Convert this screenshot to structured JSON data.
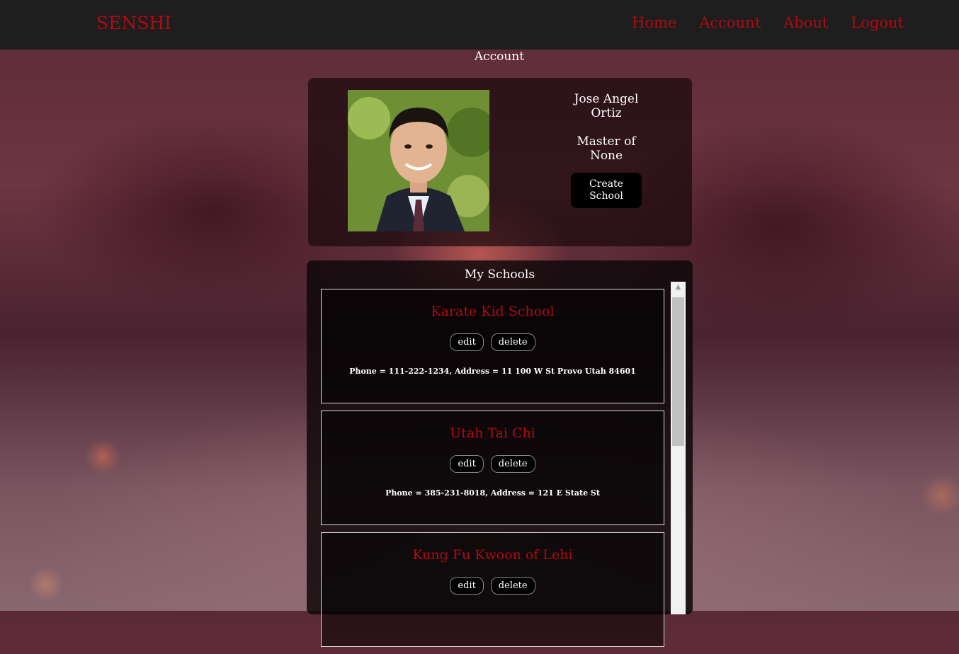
{
  "nav": {
    "brand": "SENSHI",
    "links": [
      "Home",
      "Account",
      "About",
      "Logout"
    ]
  },
  "page": {
    "title": "Account"
  },
  "profile": {
    "name": "Jose Angel Ortiz",
    "rank": "Master of None",
    "create_button": "Create School"
  },
  "schools": {
    "title": "My Schools",
    "edit_label": "edit",
    "delete_label": "delete",
    "items": [
      {
        "name": "Karate Kid School",
        "details": "Phone = 111-222-1234, Address = 11 100 W St Provo Utah 84601"
      },
      {
        "name": "Utah Tai Chi",
        "details": "Phone = 385-231-8018, Address = 121 E State St"
      },
      {
        "name": "Kung Fu Kwoon of Lehi",
        "details": ""
      }
    ]
  },
  "colors": {
    "accent": "#b00a12",
    "navbar": "#1e1e1e"
  }
}
